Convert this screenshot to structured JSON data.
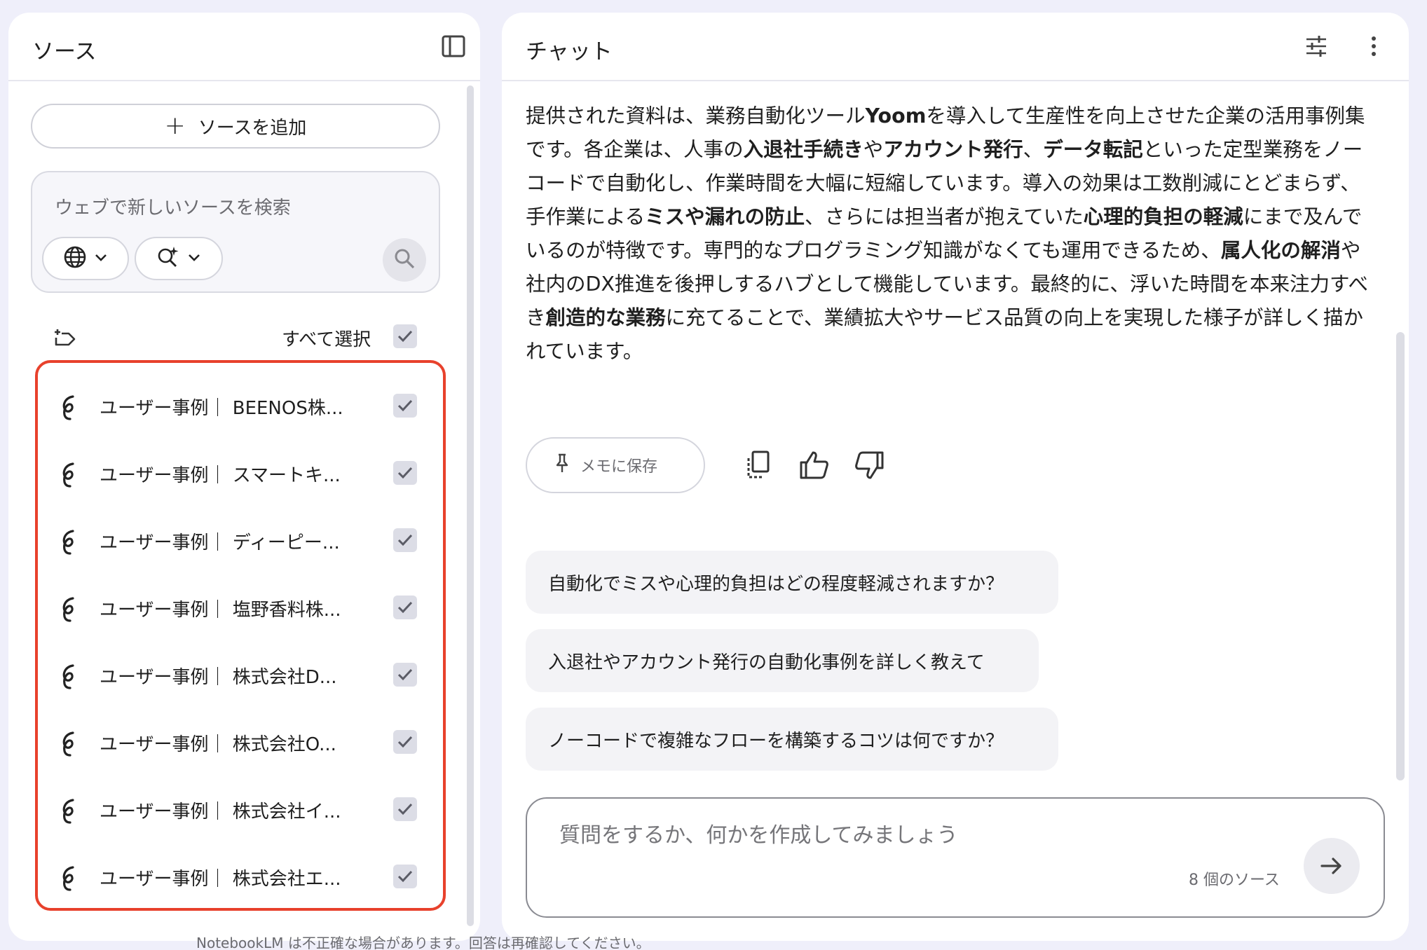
{
  "sources_panel": {
    "title": "ソース",
    "add_source_label": "ソースを追加",
    "web_search_placeholder": "ウェブで新しいソースを検索",
    "select_all_label": "すべて選択",
    "items": [
      {
        "label": "ユーザー事例｜ BEENOS株...",
        "checked": true
      },
      {
        "label": "ユーザー事例｜ スマートキ...",
        "checked": true
      },
      {
        "label": "ユーザー事例｜ ディーピー...",
        "checked": true
      },
      {
        "label": "ユーザー事例｜ 塩野香料株...",
        "checked": true
      },
      {
        "label": "ユーザー事例｜ 株式会社D...",
        "checked": true
      },
      {
        "label": "ユーザー事例｜ 株式会社O...",
        "checked": true
      },
      {
        "label": "ユーザー事例｜ 株式会社イ...",
        "checked": true
      },
      {
        "label": "ユーザー事例｜ 株式会社エ...",
        "checked": true
      }
    ]
  },
  "chat_panel": {
    "title": "チャット",
    "answer": {
      "t1": "提供された資料は、業務自動化ツール",
      "b1": "Yoom",
      "t2": "を導入して生産性を向上させた企業の活用事例集です。各企業は、人事の",
      "b2": "入退社手続き",
      "t3": "や",
      "b3": "アカウント発行",
      "t4": "、",
      "b4": "データ転記",
      "t5": "といった定型業務をノーコードで自動化し、作業時間を大幅に短縮しています。導入の効果は工数削減にとどまらず、手作業による",
      "b5": "ミスや漏れの防止",
      "t6": "、さらには担当者が抱えていた",
      "b6": "心理的負担の軽減",
      "t7": "にまで及んでいるのが特徴です。専門的なプログラミング知識がなくても運用できるため、",
      "b7": "属人化の解消",
      "t8": "や社内のDX推進を後押しするハブとして機能しています。最終的に、浮いた時間を本来注力すべき",
      "b8": "創造的な業務",
      "t9": "に充てることで、業績拡大やサービス品質の向上を実現した様子が詳しく描かれています。"
    },
    "save_memo_label": "メモに保存",
    "suggestions": [
      "自動化でミスや心理的負担はどの程度軽減されますか？",
      "入退社やアカウント発行の自動化事例を詳しく教えて",
      "ノーコードで複雑なフローを構築するコツは何ですか？"
    ],
    "input_placeholder": "質問をするか、何かを作成してみましょう",
    "source_count": "8 個のソース",
    "disclaimer": "NotebookLM は不正確な場合があります。回答は再確認してください。"
  },
  "colors": {
    "background": "#efeffa",
    "highlight_border": "#e8412c",
    "checkbox_fill": "#dcdde6"
  },
  "icons": [
    "panel-toggle-icon",
    "plus-icon",
    "globe-icon",
    "chevron-down-icon",
    "sparkle-search-icon",
    "search-icon",
    "select-all-row-icon",
    "check-icon",
    "source-link-icon",
    "tune-icon",
    "more-vert-icon",
    "pin-icon",
    "copy-icon",
    "thumb-up-icon",
    "thumb-down-icon",
    "arrow-right-icon"
  ]
}
